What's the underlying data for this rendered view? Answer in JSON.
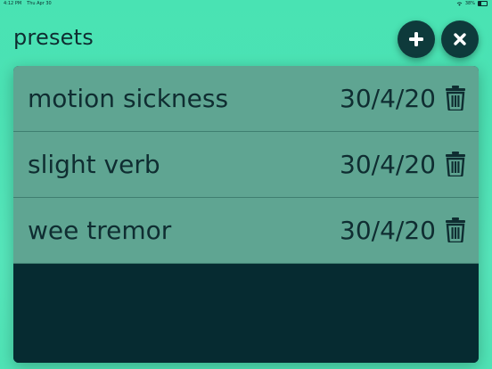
{
  "status": {
    "time": "4:12 PM",
    "date": "Thu Apr 30",
    "battery": "38%"
  },
  "header": {
    "title": "presets"
  },
  "toolbar": {
    "add_icon": "plus-icon",
    "close_icon": "close-icon"
  },
  "presets": [
    {
      "name": "motion sickness",
      "date": "30/4/20",
      "icon": "trash-icon"
    },
    {
      "name": "slight verb",
      "date": "30/4/20",
      "icon": "trash-icon"
    },
    {
      "name": "wee tremor",
      "date": "30/4/20",
      "icon": "trash-icon"
    }
  ],
  "colors": {
    "background": "#4ce2b4",
    "row": "#5fa592",
    "dark": "#0e3a3b"
  }
}
